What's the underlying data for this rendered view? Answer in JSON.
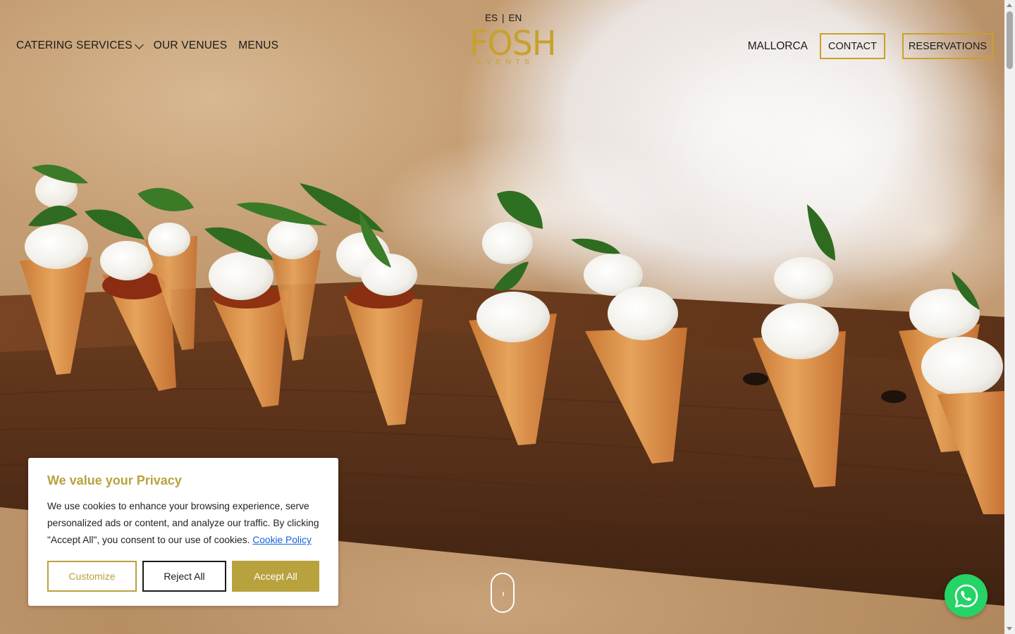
{
  "language_switch": {
    "es": "ES",
    "separator": "|",
    "en": "EN"
  },
  "logo": {
    "word": "FOSH",
    "subtitle": "EVENTS"
  },
  "nav_left": [
    {
      "label": "CATERING SERVICES",
      "has_dropdown": true
    },
    {
      "label": "OUR VENUES"
    },
    {
      "label": "MENUS"
    }
  ],
  "nav_right": {
    "location": "MALLORCA",
    "contact": "CONTACT",
    "reservations": "RESERVATIONS"
  },
  "cookie_banner": {
    "title": "We value your Privacy",
    "text": "We use cookies to enhance your browsing experience, serve personalized ads or content, and analyze our traffic. By clicking \"Accept All\", you consent to our use of cookies.",
    "policy_link": "Cookie Policy",
    "customize": "Customize",
    "reject_all": "Reject All",
    "accept_all": "Accept All"
  },
  "icons": {
    "scroll": "mouse-scroll-icon",
    "whatsapp": "whatsapp-icon",
    "dropdown": "chevron-down-icon"
  },
  "colors": {
    "brand_gold": "#c7a12c",
    "cookie_gold": "#b8a23e",
    "whatsapp_green": "#25d366",
    "link_blue": "#1863dc"
  }
}
